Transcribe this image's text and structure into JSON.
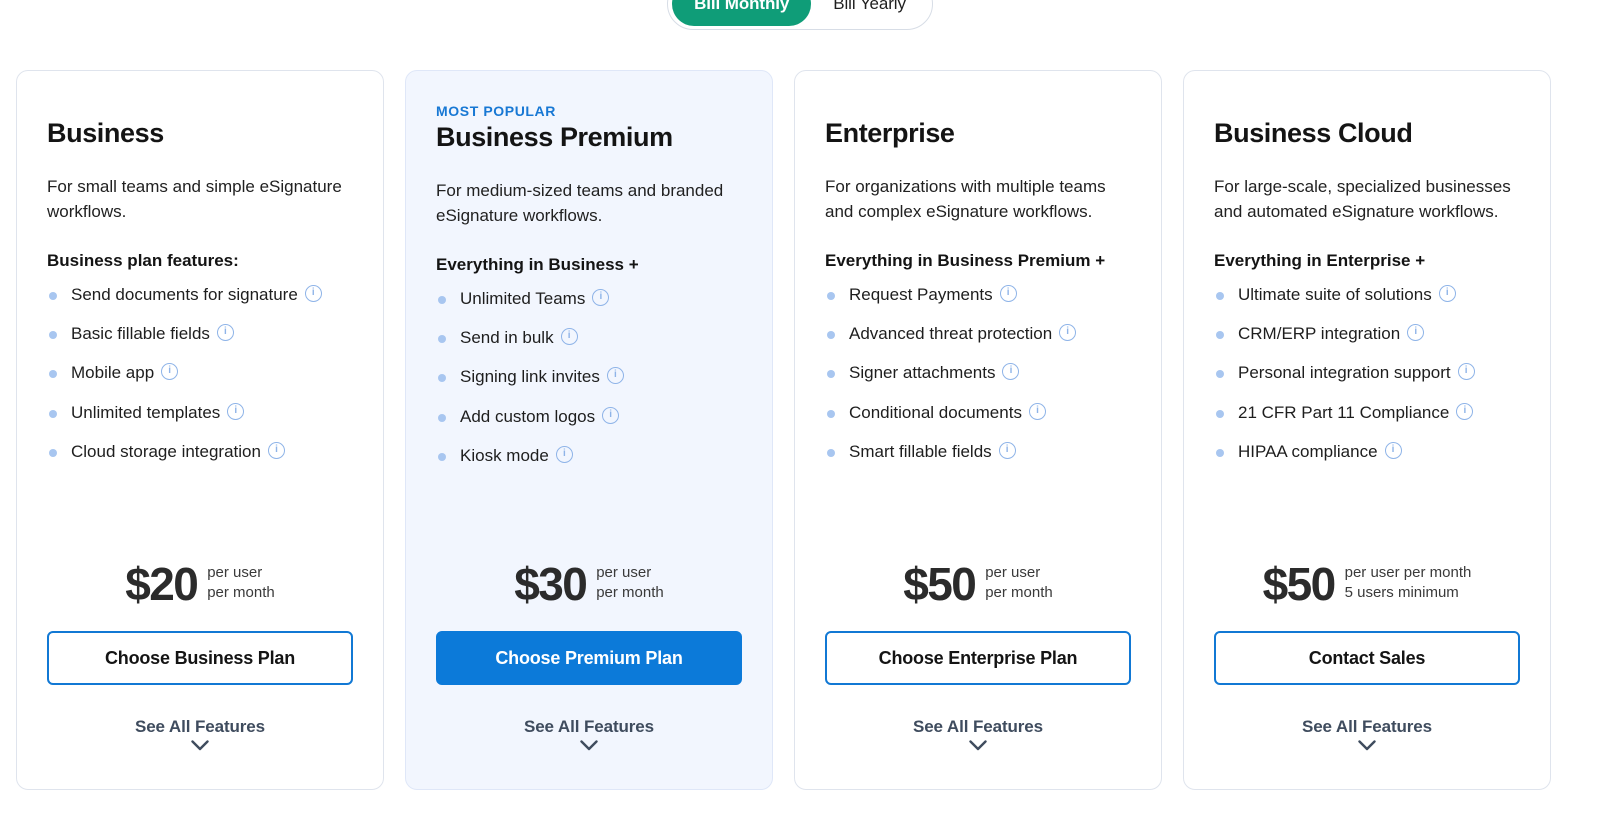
{
  "billing_toggle": {
    "options": [
      {
        "label": "Bill Monthly",
        "selected": true
      },
      {
        "label": "Bill Yearly",
        "selected": false
      }
    ]
  },
  "colors": {
    "toggle_active": "#0f9d78",
    "accent_blue": "#0c7ad9",
    "badge_blue": "#1878d4",
    "featured_bg": "#f2f6fe",
    "bullet": "#a8c6f0",
    "card_border": "#dfe4ed"
  },
  "common": {
    "see_all_features": "See All Features",
    "chevron": "chevron-down-icon",
    "info_glyph": "i"
  },
  "plans": [
    {
      "badge": "",
      "name": "Business",
      "description": "For small teams and simple eSignature workflows.",
      "features_heading": "Business plan features:",
      "features": [
        "Send documents for signature",
        "Basic fillable fields",
        "Mobile app",
        "Unlimited templates",
        "Cloud storage integration"
      ],
      "price": "$20",
      "price_note_line1": "per user",
      "price_note_line2": "per month",
      "cta_label": "Choose Business Plan",
      "cta_style": "outline",
      "featured": false
    },
    {
      "badge": "MOST POPULAR",
      "name": "Business Premium",
      "description": "For medium-sized teams and branded eSignature workflows.",
      "features_heading": "Everything in Business +",
      "features": [
        "Unlimited Teams",
        "Send in bulk",
        "Signing link invites",
        "Add custom logos",
        "Kiosk mode"
      ],
      "price": "$30",
      "price_note_line1": "per user",
      "price_note_line2": "per month",
      "cta_label": "Choose Premium Plan",
      "cta_style": "filled",
      "featured": true
    },
    {
      "badge": "",
      "name": "Enterprise",
      "description": "For organizations with multiple teams and complex eSignature workflows.",
      "features_heading": "Everything in Business Premium +",
      "features": [
        "Request Payments",
        "Advanced threat protection",
        "Signer attachments",
        "Conditional documents",
        "Smart fillable fields"
      ],
      "price": "$50",
      "price_note_line1": "per user",
      "price_note_line2": "per month",
      "cta_label": "Choose Enterprise Plan",
      "cta_style": "outline",
      "featured": false
    },
    {
      "badge": "",
      "name": "Business Cloud",
      "description": "For large-scale, specialized businesses and automated eSignature workflows.",
      "features_heading": "Everything in Enterprise +",
      "features": [
        "Ultimate suite of solutions",
        "CRM/ERP integration",
        "Personal integration support",
        "21 CFR Part 11 Compliance",
        "HIPAA compliance"
      ],
      "price": "$50",
      "price_note_line1": "per user per month",
      "price_note_line2": "5 users minimum",
      "cta_label": "Contact Sales",
      "cta_style": "outline",
      "featured": false
    }
  ]
}
